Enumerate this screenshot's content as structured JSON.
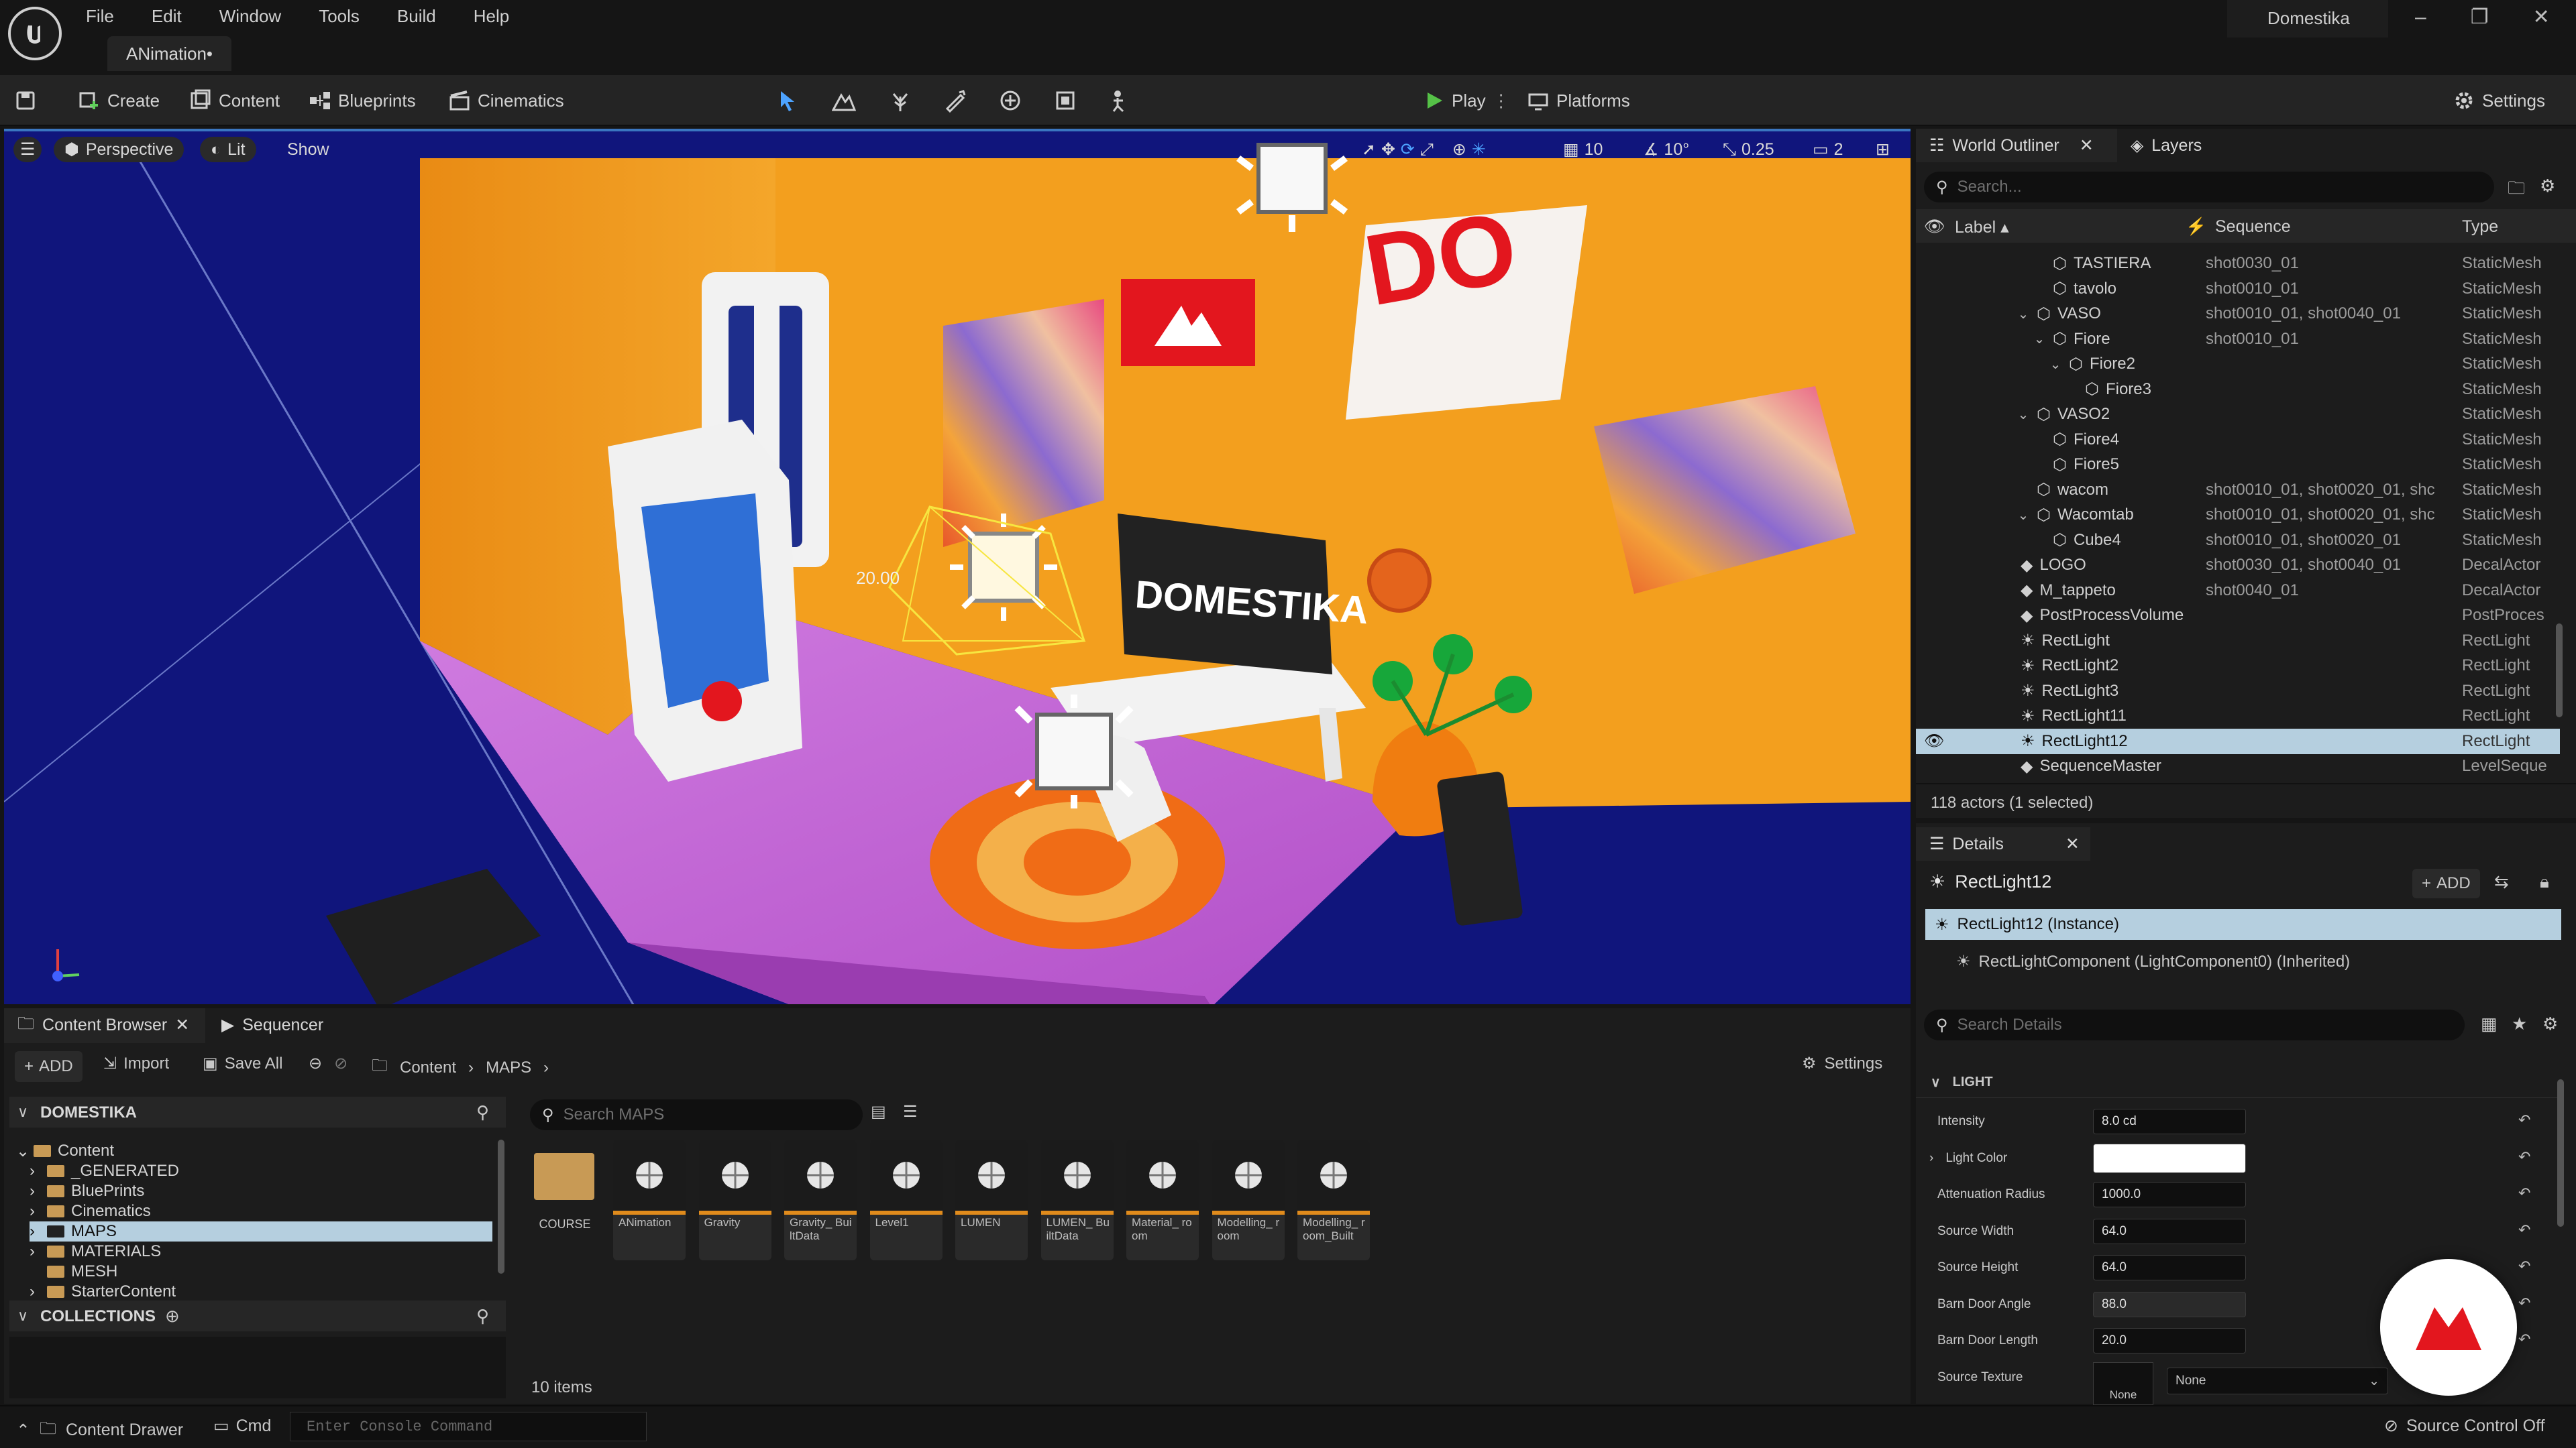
{
  "app": {
    "menu": [
      "File",
      "Edit",
      "Window",
      "Tools",
      "Build",
      "Help"
    ],
    "document_tab": "ANimation•",
    "project_name": "Domestika",
    "window_controls": [
      "–",
      "❐",
      "✕"
    ]
  },
  "toolbar": {
    "create": "Create",
    "content": "Content",
    "blueprints": "Blueprints",
    "cinematics": "Cinematics",
    "play": "Play",
    "platforms": "Platforms",
    "settings": "Settings"
  },
  "viewport": {
    "perspective": "Perspective",
    "lit": "Lit",
    "show": "Show",
    "grid_snap": "10",
    "rotation_snap": "10°",
    "scale_snap": "0.25",
    "camera_speed": "2",
    "light_label": "20.00",
    "screen_sign": "DOMESTIKA"
  },
  "outliner": {
    "tab_title": "World Outliner",
    "layers_tab": "Layers",
    "search_placeholder": "Search...",
    "col_label": "Label",
    "col_sequence": "Sequence",
    "col_type": "Type",
    "rows": [
      {
        "label": "TASTIERA",
        "sequence": "shot0030_01",
        "type": "StaticMesh",
        "indent": 4,
        "caret": ""
      },
      {
        "label": "tavolo",
        "sequence": "shot0010_01",
        "type": "StaticMesh",
        "indent": 4,
        "caret": ""
      },
      {
        "label": "VASO",
        "sequence": "shot0010_01, shot0040_01",
        "type": "StaticMesh",
        "indent": 3,
        "caret": "v"
      },
      {
        "label": "Fiore",
        "sequence": "shot0010_01",
        "type": "StaticMesh",
        "indent": 4,
        "caret": "v"
      },
      {
        "label": "Fiore2",
        "sequence": "",
        "type": "StaticMesh",
        "indent": 5,
        "caret": "v"
      },
      {
        "label": "Fiore3",
        "sequence": "",
        "type": "StaticMesh",
        "indent": 6,
        "caret": ""
      },
      {
        "label": "VASO2",
        "sequence": "",
        "type": "StaticMesh",
        "indent": 3,
        "caret": "v"
      },
      {
        "label": "Fiore4",
        "sequence": "",
        "type": "StaticMesh",
        "indent": 4,
        "caret": ""
      },
      {
        "label": "Fiore5",
        "sequence": "",
        "type": "StaticMesh",
        "indent": 4,
        "caret": ""
      },
      {
        "label": "wacom",
        "sequence": "shot0010_01, shot0020_01, shc",
        "type": "StaticMesh",
        "indent": 3,
        "caret": ""
      },
      {
        "label": "Wacomtab",
        "sequence": "shot0010_01, shot0020_01, shc",
        "type": "StaticMesh",
        "indent": 3,
        "caret": "v"
      },
      {
        "label": "Cube4",
        "sequence": "shot0010_01, shot0020_01",
        "type": "StaticMesh",
        "indent": 4,
        "caret": ""
      },
      {
        "label": "LOGO",
        "sequence": "shot0030_01, shot0040_01",
        "type": "DecalActor",
        "indent": 2,
        "caret": ""
      },
      {
        "label": "M_tappeto",
        "sequence": "shot0040_01",
        "type": "DecalActor",
        "indent": 2,
        "caret": ""
      },
      {
        "label": "PostProcessVolume",
        "sequence": "",
        "type": "PostProces",
        "indent": 2,
        "caret": ""
      },
      {
        "label": "RectLight",
        "sequence": "",
        "type": "RectLight",
        "indent": 2,
        "caret": ""
      },
      {
        "label": "RectLight2",
        "sequence": "",
        "type": "RectLight",
        "indent": 2,
        "caret": ""
      },
      {
        "label": "RectLight3",
        "sequence": "",
        "type": "RectLight",
        "indent": 2,
        "caret": ""
      },
      {
        "label": "RectLight11",
        "sequence": "",
        "type": "RectLight",
        "indent": 2,
        "caret": ""
      },
      {
        "label": "RectLight12",
        "sequence": "",
        "type": "RectLight",
        "indent": 2,
        "caret": "",
        "selected": true
      },
      {
        "label": "SequenceMaster",
        "sequence": "",
        "type": "LevelSeque",
        "indent": 2,
        "caret": ""
      }
    ],
    "status": "118 actors (1 selected)"
  },
  "details": {
    "tab_title": "Details",
    "object_name": "RectLight12",
    "add_button": "ADD",
    "instance": "RectLight12 (Instance)",
    "component": "RectLightComponent (LightComponent0) (Inherited)",
    "search_placeholder": "Search Details",
    "section": "LIGHT",
    "properties": [
      {
        "label": "Intensity",
        "value": "8.0 cd"
      },
      {
        "label": "Light Color",
        "value": ""
      },
      {
        "label": "Attenuation Radius",
        "value": "1000.0"
      },
      {
        "label": "Source Width",
        "value": "64.0"
      },
      {
        "label": "Source Height",
        "value": "64.0"
      },
      {
        "label": "Barn Door Angle",
        "value": "88.0"
      },
      {
        "label": "Barn Door Length",
        "value": "20.0"
      },
      {
        "label": "Source Texture",
        "value": "None"
      }
    ],
    "source_texture_thumb": "None",
    "source_texture_select": "None"
  },
  "content_browser": {
    "tab_title": "Content Browser",
    "sequencer_tab": "Sequencer",
    "add": "ADD",
    "import": "Import",
    "save_all": "Save All",
    "breadcrumb": [
      "Content",
      "MAPS"
    ],
    "settings": "Settings",
    "project_root": "DOMESTIKA",
    "tree": [
      {
        "label": "Content",
        "depth": 0,
        "caret": "v"
      },
      {
        "label": "_GENERATED",
        "depth": 1,
        "caret": ">"
      },
      {
        "label": "BluePrints",
        "depth": 1,
        "caret": ">"
      },
      {
        "label": "Cinematics",
        "depth": 1,
        "caret": ">"
      },
      {
        "label": "MAPS",
        "depth": 1,
        "caret": ">",
        "selected": true
      },
      {
        "label": "MATERIALS",
        "depth": 1,
        "caret": ">"
      },
      {
        "label": "MESH",
        "depth": 1,
        "caret": ""
      },
      {
        "label": "StarterContent",
        "depth": 1,
        "caret": ">"
      }
    ],
    "collections": "COLLECTIONS",
    "search_placeholder": "Search MAPS",
    "folder": "COURSE",
    "assets": [
      "ANimation",
      "Gravity",
      "Gravity_ BuiltData",
      "Level1",
      "LUMEN",
      "LUMEN_ BuiltData",
      "Material_ room",
      "Modelling_ room",
      "Modelling_ room_Built"
    ],
    "count": "10 items"
  },
  "statusbar": {
    "content_drawer": "Content Drawer",
    "cmd": "Cmd",
    "console_placeholder": "Enter Console Command",
    "source_control": "Source Control Off"
  },
  "colors": {
    "accent_blue": "#3a76c0",
    "selection": "#b5cfdf",
    "play_green": "#55c147",
    "asset_bar": "#e08b1c",
    "room_orange": "#f2a021",
    "floor_magenta": "#c565d8",
    "domestika_red": "#e3161e"
  }
}
